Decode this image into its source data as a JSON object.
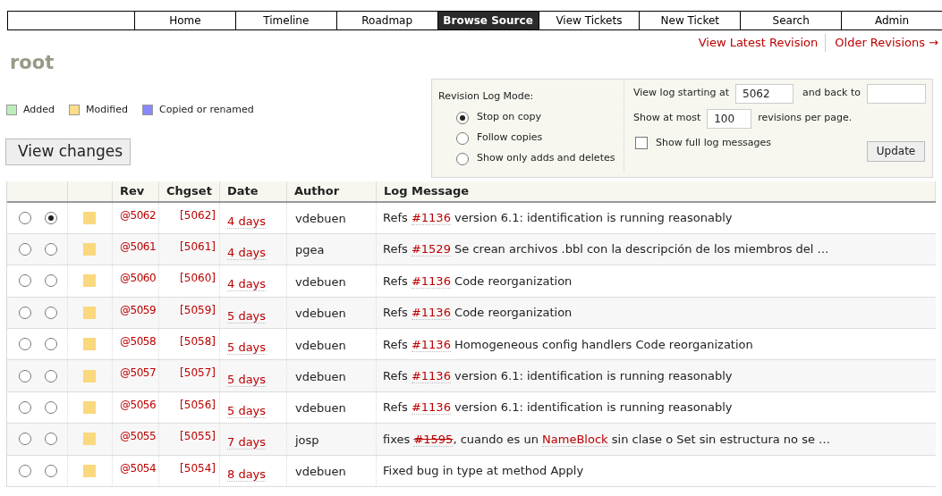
{
  "nav": [
    {
      "label": "Home",
      "selected": false
    },
    {
      "label": "Timeline",
      "selected": false
    },
    {
      "label": "Roadmap",
      "selected": false
    },
    {
      "label": "Browse Source",
      "selected": true
    },
    {
      "label": "View Tickets",
      "selected": false
    },
    {
      "label": "New Ticket",
      "selected": false
    },
    {
      "label": "Search",
      "selected": false
    },
    {
      "label": "Admin",
      "selected": false
    }
  ],
  "context_links": [
    "View Latest Revision",
    "Older Revisions →"
  ],
  "title": "root",
  "legend": [
    {
      "label": "Added",
      "color": "#bbeebb"
    },
    {
      "label": "Modified",
      "color": "#ffdd88"
    },
    {
      "label": "Copied or renamed",
      "color": "#8888ff"
    }
  ],
  "view_changes_button": "View changes",
  "log_options": {
    "mode_label": "Revision Log Mode:",
    "modes": [
      {
        "label": "Stop on copy",
        "selected": true
      },
      {
        "label": "Follow copies",
        "selected": false
      },
      {
        "label": "Show only adds and deletes",
        "selected": false
      }
    ],
    "start_label": "View log starting at",
    "start_value": "5062",
    "back_label": "and back to",
    "limit_label": "Show at most",
    "limit_value": "100",
    "limit_suffix": "revisions per page.",
    "full_messages": {
      "label": "Show full log messages",
      "checked": false
    },
    "update_button": "Update"
  },
  "table": {
    "columns": [
      "Rev",
      "Chgset",
      "Date",
      "Author",
      "Log Message"
    ],
    "rows": [
      {
        "old_selected": false,
        "new_selected": true,
        "color": "#fad87e",
        "rev": "@5062",
        "chgset": "[5062]",
        "date": "4 days",
        "author": "vdebuen",
        "message": [
          {
            "kind": "plain",
            "text": "Refs "
          },
          {
            "kind": "link",
            "text": "#1136"
          },
          {
            "kind": "plain",
            "text": " version 6.1: identification is running reasonably"
          }
        ]
      },
      {
        "old_selected": false,
        "new_selected": false,
        "color": "#fad87e",
        "rev": "@5061",
        "chgset": "[5061]",
        "date": "4 days",
        "author": "pgea",
        "message": [
          {
            "kind": "plain",
            "text": "Refs "
          },
          {
            "kind": "link",
            "text": "#1529"
          },
          {
            "kind": "plain",
            "text": " Se crean archivos .bbl con la descripción de los miembros del …"
          }
        ]
      },
      {
        "old_selected": false,
        "new_selected": false,
        "color": "#fad87e",
        "rev": "@5060",
        "chgset": "[5060]",
        "date": "4 days",
        "author": "vdebuen",
        "message": [
          {
            "kind": "plain",
            "text": "Refs "
          },
          {
            "kind": "link",
            "text": "#1136"
          },
          {
            "kind": "plain",
            "text": " Code reorganization"
          }
        ]
      },
      {
        "old_selected": false,
        "new_selected": false,
        "color": "#fad87e",
        "rev": "@5059",
        "chgset": "[5059]",
        "date": "5 days",
        "author": "vdebuen",
        "message": [
          {
            "kind": "plain",
            "text": "Refs "
          },
          {
            "kind": "link",
            "text": "#1136"
          },
          {
            "kind": "plain",
            "text": " Code reorganization"
          }
        ]
      },
      {
        "old_selected": false,
        "new_selected": false,
        "color": "#fad87e",
        "rev": "@5058",
        "chgset": "[5058]",
        "date": "5 days",
        "author": "vdebuen",
        "message": [
          {
            "kind": "plain",
            "text": "Refs "
          },
          {
            "kind": "link",
            "text": "#1136"
          },
          {
            "kind": "plain",
            "text": " Homogeneous config handlers Code reorganization"
          }
        ]
      },
      {
        "old_selected": false,
        "new_selected": false,
        "color": "#fad87e",
        "rev": "@5057",
        "chgset": "[5057]",
        "date": "5 days",
        "author": "vdebuen",
        "message": [
          {
            "kind": "plain",
            "text": "Refs "
          },
          {
            "kind": "link",
            "text": "#1136"
          },
          {
            "kind": "plain",
            "text": " version 6.1: identification is running reasonably"
          }
        ]
      },
      {
        "old_selected": false,
        "new_selected": false,
        "color": "#fad87e",
        "rev": "@5056",
        "chgset": "[5056]",
        "date": "5 days",
        "author": "vdebuen",
        "message": [
          {
            "kind": "plain",
            "text": "Refs "
          },
          {
            "kind": "link",
            "text": "#1136"
          },
          {
            "kind": "plain",
            "text": " version 6.1: identification is running reasonably"
          }
        ]
      },
      {
        "old_selected": false,
        "new_selected": false,
        "color": "#fad87e",
        "rev": "@5055",
        "chgset": "[5055]",
        "date": "7 days",
        "author": "josp",
        "message": [
          {
            "kind": "plain",
            "text": "fixes "
          },
          {
            "kind": "closed_link",
            "text": "#1595"
          },
          {
            "kind": "plain",
            "text": ", cuando es un "
          },
          {
            "kind": "link",
            "text": "NameBlock"
          },
          {
            "kind": "plain",
            "text": " sin clase o Set sin estructura no se …"
          }
        ]
      },
      {
        "old_selected": false,
        "new_selected": false,
        "color": "#fad87e",
        "rev": "@5054",
        "chgset": "[5054]",
        "date": "8 days",
        "author": "vdebuen",
        "message": [
          {
            "kind": "plain",
            "text": "Fixed bug in type at method Apply"
          }
        ]
      }
    ]
  }
}
